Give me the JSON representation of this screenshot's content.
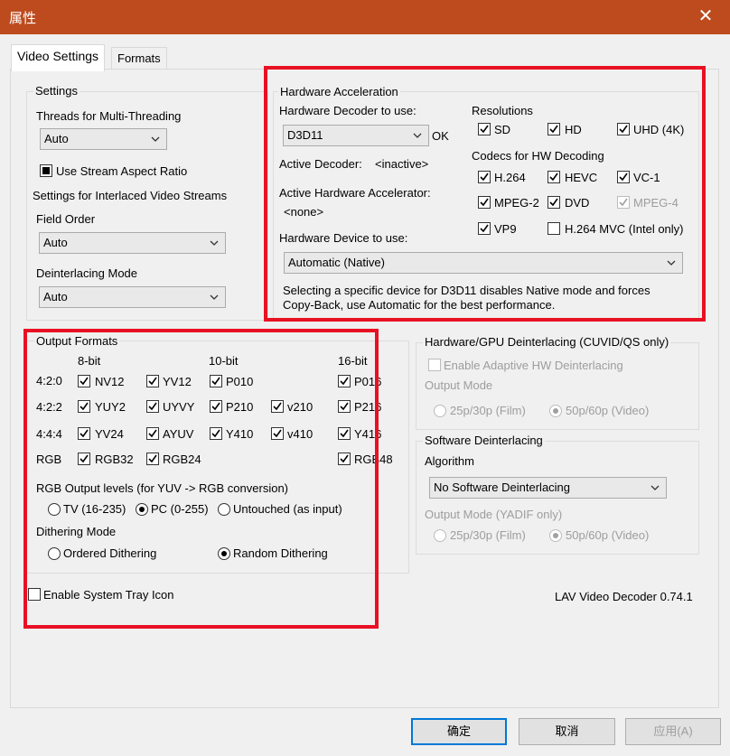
{
  "window": {
    "title": "属性"
  },
  "tabs": [
    {
      "label": "Video Settings"
    },
    {
      "label": "Formats"
    }
  ],
  "settings": {
    "title": "Settings",
    "threads_label": "Threads for Multi-Threading",
    "threads_value": "Auto",
    "aspect_ratio_label": "Use Stream Aspect Ratio",
    "interlaced_label": "Settings for Interlaced Video Streams",
    "field_order_label": "Field Order",
    "field_order_value": "Auto",
    "deint_mode_label": "Deinterlacing Mode",
    "deint_mode_value": "Auto"
  },
  "hw": {
    "title": "Hardware Acceleration",
    "decoder_label": "Hardware Decoder to use:",
    "decoder_value": "D3D11",
    "decoder_status": "OK",
    "active_decoder_label": "Active Decoder:",
    "active_decoder_value": "<inactive>",
    "active_accel_label": "Active Hardware Accelerator:",
    "active_accel_value": "<none>",
    "device_label": "Hardware Device to use:",
    "device_value": "Automatic (Native)",
    "note": "Selecting a specific device for D3D11 disables Native mode and forces Copy-Back, use Automatic for the best performance.",
    "resolutions_label": "Resolutions",
    "res": {
      "sd": "SD",
      "hd": "HD",
      "uhd": "UHD (4K)"
    },
    "codecs_label": "Codecs for HW Decoding",
    "codec": {
      "h264": "H.264",
      "hevc": "HEVC",
      "vc1": "VC-1",
      "mpeg2": "MPEG-2",
      "dvd": "DVD",
      "mpeg4": "MPEG-4",
      "vp9": "VP9",
      "h264mvc": "H.264 MVC (Intel only)"
    }
  },
  "output": {
    "title": "Output Formats",
    "cols": {
      "b8": "8-bit",
      "b10": "10-bit",
      "b16": "16-bit"
    },
    "rows": {
      "r420": "4:2:0",
      "r422": "4:2:2",
      "r444": "4:4:4",
      "rgb": "RGB"
    },
    "fmt": {
      "nv12": "NV12",
      "yv12": "YV12",
      "p010": "P010",
      "p016": "P016",
      "yuy2": "YUY2",
      "uyvy": "UYVY",
      "p210": "P210",
      "v210": "v210",
      "p216": "P216",
      "yv24": "YV24",
      "ayuv": "AYUV",
      "y410": "Y410",
      "v410": "v410",
      "y416": "Y416",
      "rgb32": "RGB32",
      "rgb24": "RGB24",
      "rgb48": "RGB48"
    },
    "levels_label": "RGB Output levels (for YUV -> RGB conversion)",
    "levels": {
      "tv": "TV (16-235)",
      "pc": "PC (0-255)",
      "untouched": "Untouched (as input)"
    },
    "dither_label": "Dithering Mode",
    "dither": {
      "ordered": "Ordered Dithering",
      "random": "Random Dithering"
    }
  },
  "tray_label": "Enable System Tray Icon",
  "gpu_deint": {
    "title": "Hardware/GPU Deinterlacing (CUVID/QS only)",
    "adaptive_label": "Enable Adaptive HW Deinterlacing",
    "output_mode_label": "Output Mode",
    "film": "25p/30p (Film)",
    "video": "50p/60p (Video)"
  },
  "sw_deint": {
    "title": "Software Deinterlacing",
    "algorithm_label": "Algorithm",
    "algorithm_value": "No Software Deinterlacing",
    "output_mode_label": "Output Mode (YADIF only)",
    "film": "25p/30p (Film)",
    "video": "50p/60p (Video)"
  },
  "version": "LAV Video Decoder 0.74.1",
  "buttons": {
    "ok": "确定",
    "cancel": "取消",
    "apply": "应用(A)"
  },
  "colors": {
    "titlebar": "#bd4b1e",
    "highlight": "#e81123",
    "default_button_border": "#0078d7"
  }
}
